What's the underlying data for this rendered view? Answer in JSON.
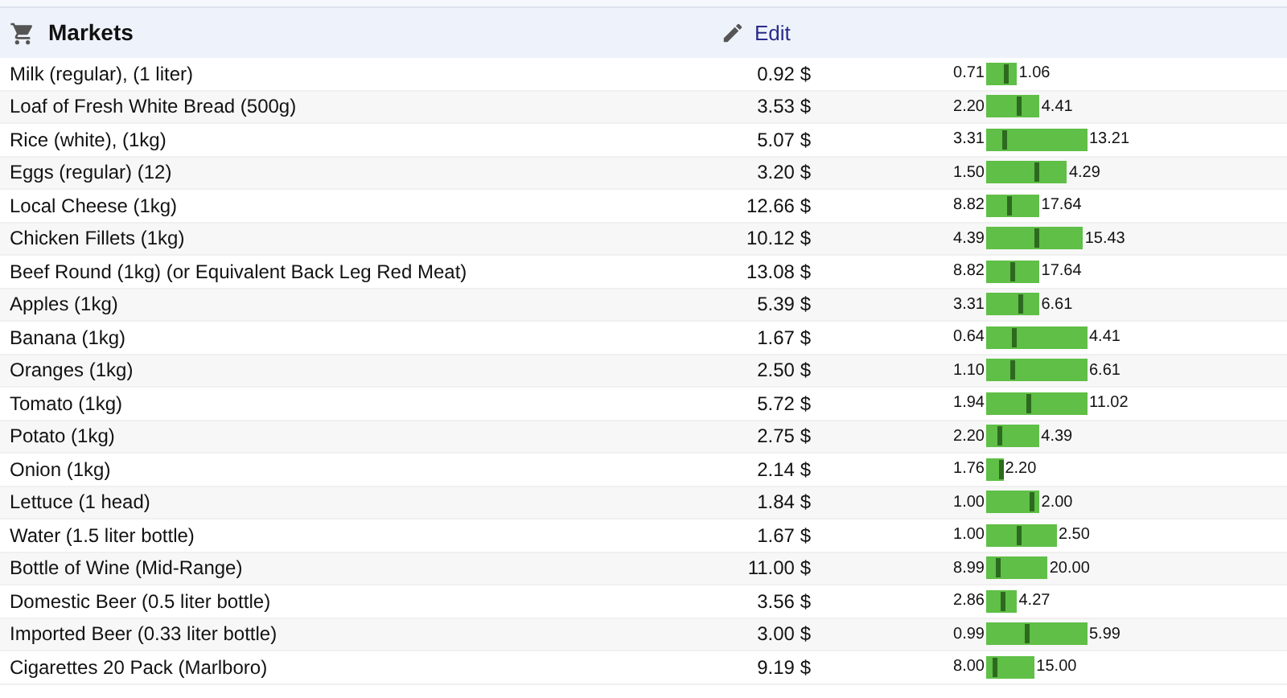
{
  "section": {
    "title": "Markets",
    "edit_label": "Edit"
  },
  "rows": [
    {
      "name": "Milk (regular), (1 liter)",
      "price": "0.92 $",
      "min": "0.71",
      "max": "1.06"
    },
    {
      "name": "Loaf of Fresh White Bread (500g)",
      "price": "3.53 $",
      "min": "2.20",
      "max": "4.41"
    },
    {
      "name": "Rice (white), (1kg)",
      "price": "5.07 $",
      "min": "3.31",
      "max": "13.21"
    },
    {
      "name": "Eggs (regular) (12)",
      "price": "3.20 $",
      "min": "1.50",
      "max": "4.29"
    },
    {
      "name": "Local Cheese (1kg)",
      "price": "12.66 $",
      "min": "8.82",
      "max": "17.64"
    },
    {
      "name": "Chicken Fillets (1kg)",
      "price": "10.12 $",
      "min": "4.39",
      "max": "15.43"
    },
    {
      "name": "Beef Round (1kg) (or Equivalent Back Leg Red Meat)",
      "price": "13.08 $",
      "min": "8.82",
      "max": "17.64"
    },
    {
      "name": "Apples (1kg)",
      "price": "5.39 $",
      "min": "3.31",
      "max": "6.61"
    },
    {
      "name": "Banana (1kg)",
      "price": "1.67 $",
      "min": "0.64",
      "max": "4.41"
    },
    {
      "name": "Oranges (1kg)",
      "price": "2.50 $",
      "min": "1.10",
      "max": "6.61"
    },
    {
      "name": "Tomato (1kg)",
      "price": "5.72 $",
      "min": "1.94",
      "max": "11.02"
    },
    {
      "name": "Potato (1kg)",
      "price": "2.75 $",
      "min": "2.20",
      "max": "4.39"
    },
    {
      "name": "Onion (1kg)",
      "price": "2.14 $",
      "min": "1.76",
      "max": "2.20"
    },
    {
      "name": "Lettuce (1 head)",
      "price": "1.84 $",
      "min": "1.00",
      "max": "2.00"
    },
    {
      "name": "Water (1.5 liter bottle)",
      "price": "1.67 $",
      "min": "1.00",
      "max": "2.50"
    },
    {
      "name": "Bottle of Wine (Mid-Range)",
      "price": "11.00 $",
      "min": "8.99",
      "max": "20.00"
    },
    {
      "name": "Domestic Beer (0.5 liter bottle)",
      "price": "3.56 $",
      "min": "2.86",
      "max": "4.27"
    },
    {
      "name": "Imported Beer (0.33 liter bottle)",
      "price": "3.00 $",
      "min": "0.99",
      "max": "5.99"
    },
    {
      "name": "Cigarettes 20 Pack (Marlboro)",
      "price": "9.19 $",
      "min": "8.00",
      "max": "15.00"
    }
  ]
}
